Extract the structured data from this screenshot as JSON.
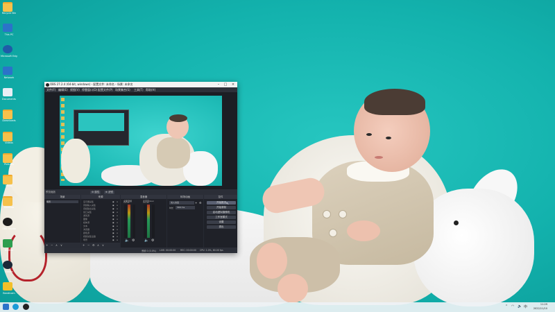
{
  "desktop": {
    "icons": [
      {
        "label": "Recycle Bin",
        "icon": "folder-icon"
      },
      {
        "label": "This PC",
        "icon": "computer-icon"
      },
      {
        "label": "Microsoft Edge",
        "icon": "app-icon"
      },
      {
        "label": "Network",
        "icon": "network-icon"
      },
      {
        "label": "Documents",
        "icon": "document-icon"
      },
      {
        "label": "Downloads",
        "icon": "folder-icon"
      },
      {
        "label": "Videos",
        "icon": "folder-icon"
      },
      {
        "label": "Pictures",
        "icon": "folder-icon"
      },
      {
        "label": "Music",
        "icon": "folder-icon"
      },
      {
        "label": "Desktop",
        "icon": "folder-icon"
      },
      {
        "label": "OBS Studio",
        "icon": "obs-icon"
      },
      {
        "label": "NVIDIA",
        "icon": "nvidia-icon"
      },
      {
        "label": "Steam",
        "icon": "steam-icon"
      },
      {
        "label": "Bandicam",
        "icon": "record-icon"
      }
    ]
  },
  "obs": {
    "title": "OBS 27.2.4 (64-bit, windows) - 配置文件: 未命名 - 场景: 未命名",
    "menu": [
      "文件(F)",
      "编辑(E)",
      "视图(V)",
      "停靠窗口(D)",
      "配置文件(P)",
      "场景集合(S)",
      "工具(T)",
      "帮助(H)"
    ],
    "preview_bar": {
      "label": "预览缩放",
      "btn_left": "⚙ 属性",
      "btn_right": "⊕ 滤镜"
    },
    "docks": {
      "scenes": {
        "title": "场景",
        "items": [
          "场景"
        ]
      },
      "sources": {
        "title": "来源",
        "items": [
          "显示器采集",
          "音频输入采集",
          "音频输出采集",
          "窗口采集",
          "游戏源",
          "图像",
          "媒体源",
          "文本",
          "浏览器",
          "颜色源",
          "视频采集设备",
          "场景"
        ]
      },
      "mixer": {
        "title": "混音器",
        "channels": [
          "桌面音频",
          "麦克风/Aux"
        ],
        "levels": [
          "0.0 dB",
          "0.0 dB"
        ]
      },
      "transitions": {
        "title": "转场动画",
        "type_label": "淡入淡出",
        "duration_label": "时长",
        "duration_value": "300 ms"
      },
      "controls": {
        "title": "控件",
        "buttons": [
          "开始推流",
          "开始录制",
          "启动虚拟摄像机",
          "工作室模式",
          "设置",
          "退出"
        ]
      }
    },
    "status": {
      "live": "LIVE: 00:00:00",
      "rec": "REC: 00:00:00",
      "cpu": "CPU: 1.0%, 60.00 fps",
      "dropped": "丢帧 0 (0.0%)"
    }
  },
  "taskbar": {
    "time": "11:29",
    "date": "2022/11/10"
  }
}
